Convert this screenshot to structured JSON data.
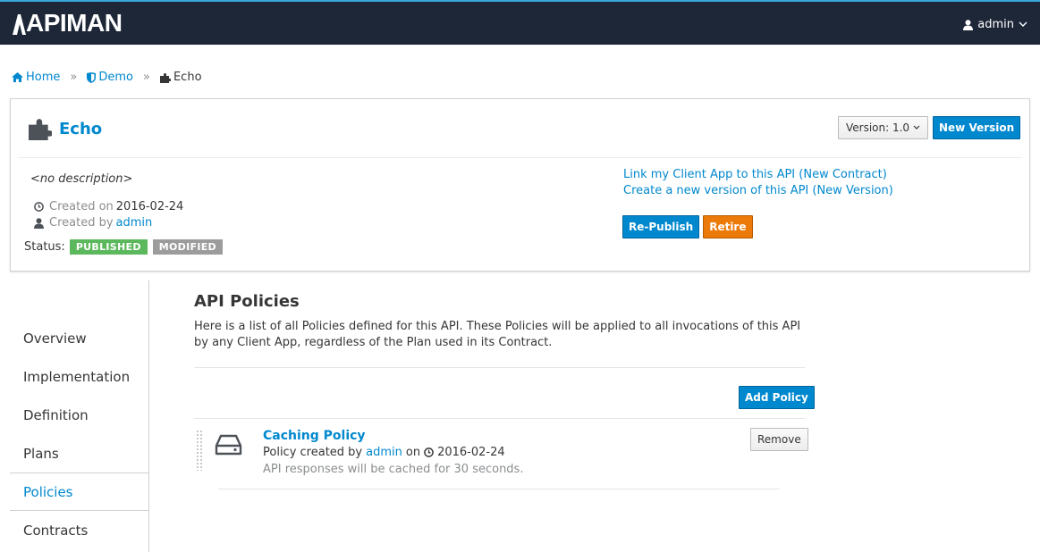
{
  "app": {
    "logo_text": "APIMAN",
    "user": "admin",
    "colors": {
      "topbar": "#1d2738",
      "accent": "#0088ce",
      "published": "#5cb85c",
      "modified": "#9c9c9c",
      "retire": "#ec7a08"
    }
  },
  "breadcrumb": {
    "home": "Home",
    "org": "Demo",
    "api": "Echo"
  },
  "api": {
    "name": "Echo",
    "version_label": "Version: 1.0",
    "new_version_label": "New Version",
    "description": "<no description>",
    "created_on_label": "Created on",
    "created_on": "2016-02-24",
    "created_by_label": "Created by",
    "created_by": "admin",
    "status_label": "Status:",
    "badges": [
      "PUBLISHED",
      "MODIFIED"
    ],
    "link_contract": "Link my Client App to this API (New Contract)",
    "link_new_version": "Create a new version of this API (New Version)",
    "republish_label": "Re-Publish",
    "retire_label": "Retire"
  },
  "sidenav": {
    "items": [
      "Overview",
      "Implementation",
      "Definition",
      "Plans",
      "Policies",
      "Contracts"
    ],
    "active": "Policies"
  },
  "policies_page": {
    "title": "API Policies",
    "intro": "Here is a list of all Policies defined for this API. These Policies will be applied to all invocations of this API by any Client App, regardless of the Plan used in its Contract.",
    "add_label": "Add Policy",
    "policies": [
      {
        "name": "Caching Policy",
        "created_prefix": "Policy created by",
        "created_by": "admin",
        "on_label": "on",
        "date": "2016-02-24",
        "description": "API responses will be cached for 30 seconds.",
        "remove_label": "Remove"
      }
    ]
  }
}
